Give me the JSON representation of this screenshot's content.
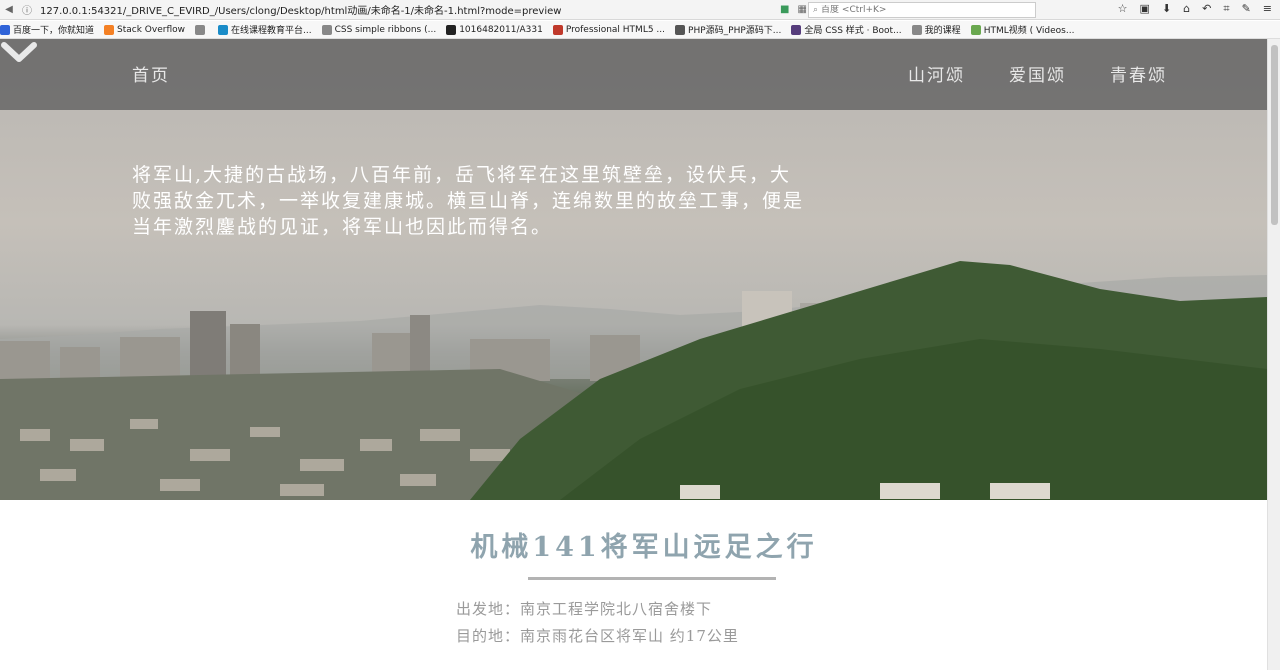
{
  "browser": {
    "url": "127.0.0.1:54321/_DRIVE_C_EVIRD_/Users/clong/Desktop/html动画/未命名-1/未命名-1.html?mode=preview",
    "search_placeholder": "百度 <Ctrl+K>"
  },
  "bookmarks": [
    {
      "label": "百度一下，你就知道",
      "icon": "baidu-icon",
      "color": "#2f63d8"
    },
    {
      "label": "Stack Overflow",
      "icon": "stackoverflow-icon",
      "color": "#f48024"
    },
    {
      "label": "",
      "icon": "globe-icon",
      "color": "#888888"
    },
    {
      "label": "在线课程教育平台...",
      "icon": "course-icon",
      "color": "#1a8cc8"
    },
    {
      "label": "CSS simple ribbons (...",
      "icon": "globe-icon",
      "color": "#888888"
    },
    {
      "label": "1016482011/A331",
      "icon": "github-icon",
      "color": "#222222"
    },
    {
      "label": "Professional HTML5 ...",
      "icon": "html5-icon",
      "color": "#c0392b"
    },
    {
      "label": "PHP源码_PHP源码下...",
      "icon": "php-icon",
      "color": "#555555"
    },
    {
      "label": "全局 CSS 样式 · Boot...",
      "icon": "bootstrap-icon",
      "color": "#563d7c"
    },
    {
      "label": "我的课程",
      "icon": "globe-icon",
      "color": "#888888"
    },
    {
      "label": "HTML视频 ( Videos...",
      "icon": "video-icon",
      "color": "#6aa84f"
    }
  ],
  "nav": {
    "home": "首页",
    "links": [
      "山河颂",
      "爱国颂",
      "青春颂"
    ]
  },
  "hero": {
    "text": "将军山,大捷的古战场，八百年前，岳飞将军在这里筑壁垒，设伏兵，大败强敌金兀术，一举收复建康城。横亘山脊，连绵数里的故垒工事，便是当年激烈鏖战的见证，将军山也因此而得名。"
  },
  "content": {
    "title": "机械141将军山远足之行",
    "departure": "出发地：南京工程学院北八宿舍楼下",
    "destination": "目的地：南京雨花台区将军山  约17公里"
  }
}
